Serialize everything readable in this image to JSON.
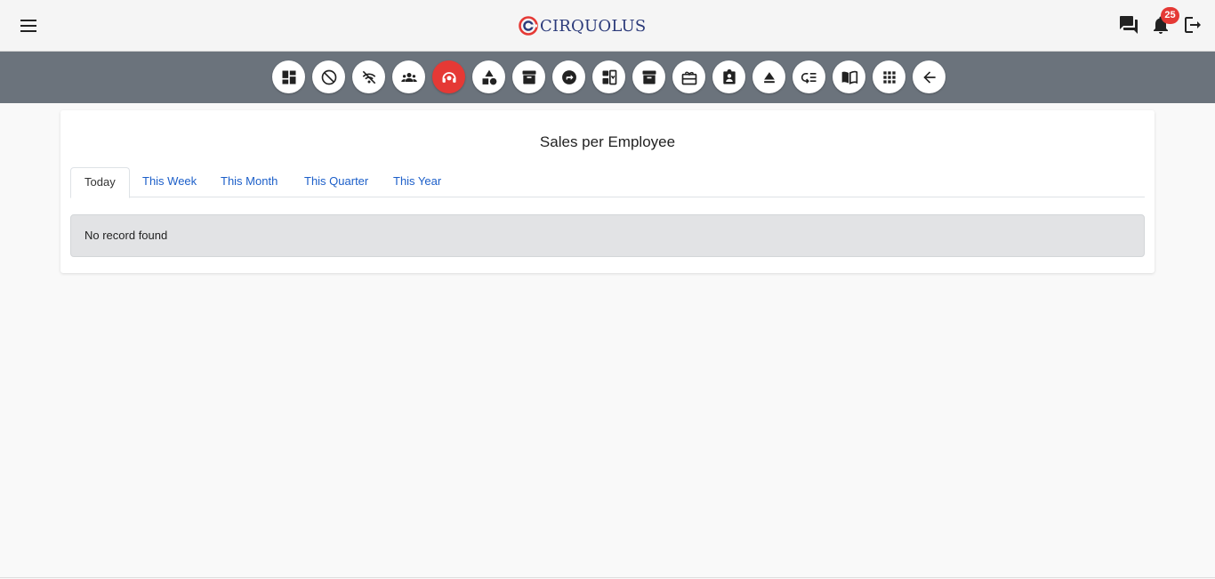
{
  "header": {
    "brand_text": "CIRQUOLUS",
    "brand_color": "#2b3a7a",
    "brand_accent": "#e53935",
    "menu_icon": "hamburger-menu-icon",
    "icons": [
      "chat-icon",
      "bell-icon",
      "logout-icon"
    ],
    "notification_count": "25"
  },
  "toolbar": {
    "buttons": [
      {
        "icon": "dashboard-icon"
      },
      {
        "icon": "block-icon"
      },
      {
        "icon": "wifi-off-icon"
      },
      {
        "icon": "groups-icon"
      },
      {
        "icon": "support-agent-icon",
        "active": true
      },
      {
        "icon": "category-icon"
      },
      {
        "icon": "inventory-icon"
      },
      {
        "icon": "directions-icon"
      },
      {
        "icon": "move-down-icon"
      },
      {
        "icon": "archive-icon"
      },
      {
        "icon": "redeem-icon"
      },
      {
        "icon": "assignment-ind-icon"
      },
      {
        "icon": "eject-icon"
      },
      {
        "icon": "low-priority-icon"
      },
      {
        "icon": "menu-book-icon"
      },
      {
        "icon": "apps-icon"
      },
      {
        "icon": "arrow-back-icon"
      }
    ],
    "active_color": "#e53935",
    "bar_color": "#6b737c"
  },
  "main": {
    "title": "Sales per Employee",
    "tabs": [
      {
        "label": "Today",
        "active": true
      },
      {
        "label": "This Week"
      },
      {
        "label": "This Month"
      },
      {
        "label": "This Quarter"
      },
      {
        "label": "This Year"
      }
    ],
    "empty_message": "No record found"
  }
}
